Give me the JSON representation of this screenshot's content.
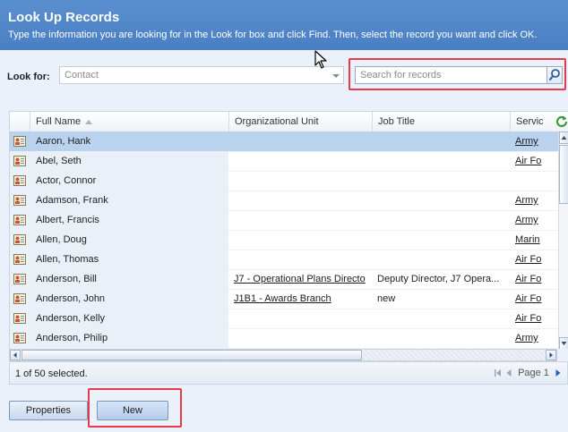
{
  "header": {
    "title": "Look Up Records",
    "subtitle": "Type the information you are looking for in the Look for box and click Find. Then, select the record you want and click OK."
  },
  "lookfor": {
    "label": "Look for:",
    "value": "Contact"
  },
  "search": {
    "placeholder": "Search for records"
  },
  "grid": {
    "columns": [
      "Full Name",
      "Organizational Unit",
      "Job Title",
      "Servic"
    ],
    "rows": [
      {
        "name": "Aaron, Hank",
        "org": "",
        "job": "",
        "service": "Army",
        "selected": true
      },
      {
        "name": "Abel, Seth",
        "org": "",
        "job": "",
        "service": "Air Fo"
      },
      {
        "name": "Actor, Connor",
        "org": "",
        "job": "",
        "service": ""
      },
      {
        "name": "Adamson, Frank",
        "org": "",
        "job": "",
        "service": "Army"
      },
      {
        "name": "Albert, Francis",
        "org": "",
        "job": "",
        "service": "Army"
      },
      {
        "name": "Allen, Doug",
        "org": "",
        "job": "",
        "service": "Marin"
      },
      {
        "name": "Allen, Thomas",
        "org": "",
        "job": "",
        "service": "Air Fo"
      },
      {
        "name": "Anderson, Bill",
        "org": "J7 - Operational Plans Directo",
        "job": "Deputy Director, J7 Opera...",
        "service": "Air Fo"
      },
      {
        "name": "Anderson, John",
        "org": "J1B1 - Awards Branch",
        "job": "new",
        "service": "Air Fo"
      },
      {
        "name": "Anderson, Kelly",
        "org": "",
        "job": "",
        "service": "Air Fo"
      },
      {
        "name": "Anderson, Philip",
        "org": "",
        "job": "",
        "service": "Army"
      }
    ]
  },
  "status": {
    "selection": "1 of 50 selected.",
    "page": "Page 1"
  },
  "buttons": {
    "properties": "Properties",
    "new": "New"
  },
  "colors": {
    "header_bg": "#4a7fc3",
    "selected_row": "#b9d3ee",
    "highlight": "#e63a48"
  },
  "icons": [
    "contact-card-icon",
    "search-icon",
    "refresh-icon",
    "sort-ascending-icon",
    "first-page-icon",
    "prev-page-icon",
    "next-page-icon",
    "mouse-cursor-icon"
  ]
}
